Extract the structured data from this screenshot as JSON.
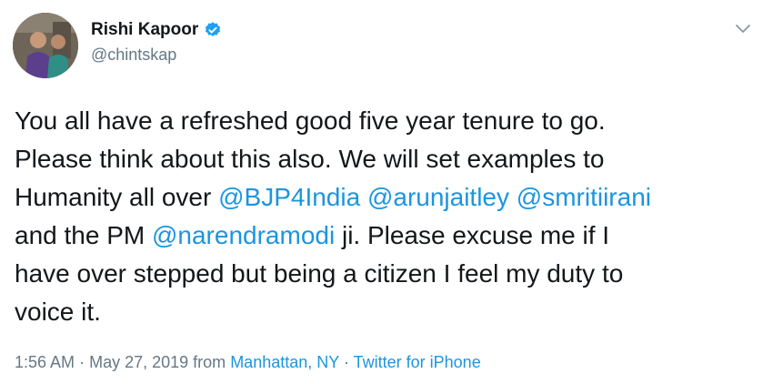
{
  "author": {
    "display_name": "Rishi Kapoor",
    "handle": "@chintskap",
    "verified": true
  },
  "tweet": {
    "line1": "You all have a refreshed good five year tenure to go.",
    "line2": "Please think about this also. We will set examples to",
    "line3_pre": "Humanity all over ",
    "mention1": "@BJP4India",
    "mention2": "@arunjaitley",
    "mention3": "@smritiirani",
    "line4_pre": "and the PM ",
    "mention4": "@narendramodi",
    "line4_post": " ji. Please excuse me if I",
    "line5": "have over stepped but being a citizen I feel my duty to",
    "line6": "voice it."
  },
  "meta": {
    "time": "1:56 AM",
    "date": "May 27, 2019",
    "from_label": "from",
    "location": "Manhattan, NY",
    "source": "Twitter for iPhone",
    "separator": "·"
  },
  "icons": {
    "verified": "verified-badge-icon",
    "menu": "chevron-down-icon"
  },
  "colors": {
    "link": "#1b95e0",
    "secondary_text": "#657786",
    "primary_text": "#14171a",
    "verified_blue": "#1da1f2"
  }
}
